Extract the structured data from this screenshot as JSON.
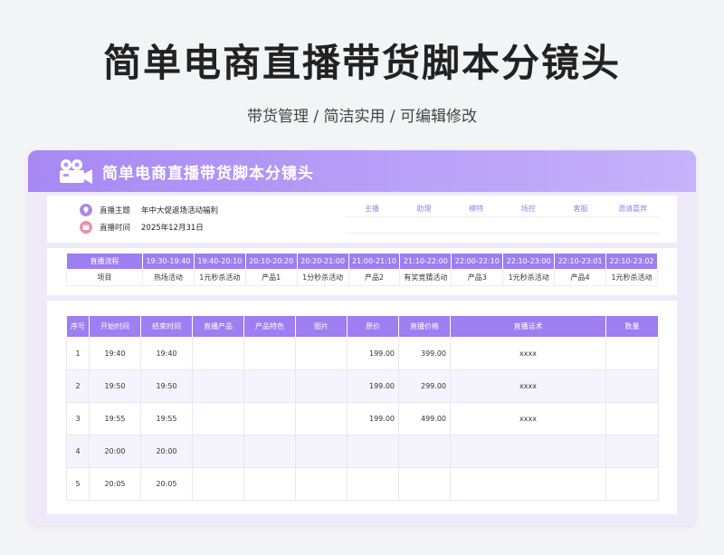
{
  "title": "简单电商直播带货脚本分镜头",
  "subtitle": "带货管理 / 简洁实用 /  可编辑修改",
  "card_title": "简单电商直播带货脚本分镜头",
  "info": {
    "theme_label": "直播主题",
    "theme_value": "年中大促返场活动福利",
    "time_label": "直播时间",
    "time_value": "2025年12月31日"
  },
  "roles": [
    "主播",
    "助理",
    "模特",
    "场控",
    "客服",
    "邀请嘉宾"
  ],
  "flow": {
    "headers": [
      "直播流程",
      "19:30-19:40",
      "19:40-20:10",
      "20:10-20:20",
      "20:20-21:00",
      "21:00-21:10",
      "21:10-22:00",
      "22:00-22:10",
      "22:10-23:00",
      "22:10-23:01",
      "22:10-23:02"
    ],
    "row": [
      "项目",
      "热场活动",
      "1元秒杀活动",
      "产品1",
      "1分秒杀活动",
      "产品2",
      "有奖竞猜活动",
      "产品3",
      "1元秒杀活动",
      "产品4",
      "1元秒杀活动"
    ]
  },
  "table": {
    "headers": [
      "序号",
      "开始时间",
      "结束时间",
      "直播产品",
      "产品特色",
      "图片",
      "原价",
      "直播价格",
      "直播话术",
      "数量"
    ],
    "rows": [
      [
        "1",
        "19:40",
        "19:40",
        "",
        "",
        "",
        "199.00",
        "399.00",
        "xxxx",
        ""
      ],
      [
        "2",
        "19:50",
        "19:50",
        "",
        "",
        "",
        "199.00",
        "299.00",
        "xxxx",
        ""
      ],
      [
        "3",
        "19:55",
        "19:55",
        "",
        "",
        "",
        "199.00",
        "499.00",
        "xxxx",
        ""
      ],
      [
        "4",
        "20:00",
        "20:00",
        "",
        "",
        "",
        "",
        "",
        "",
        ""
      ],
      [
        "5",
        "20:05",
        "20:05",
        "",
        "",
        "",
        "",
        "",
        "",
        ""
      ]
    ]
  },
  "colors": {
    "accent": "#9e7ef0",
    "header_gradient_start": "#a888f4",
    "header_gradient_end": "#c6b2fb",
    "card_bg": "#eeeaf9",
    "theme_icon": "#a98ae8",
    "time_icon": "#f08aa6"
  },
  "icons": {
    "header": "video-camera-icon",
    "theme": "location-pin-icon",
    "time": "calendar-icon"
  }
}
